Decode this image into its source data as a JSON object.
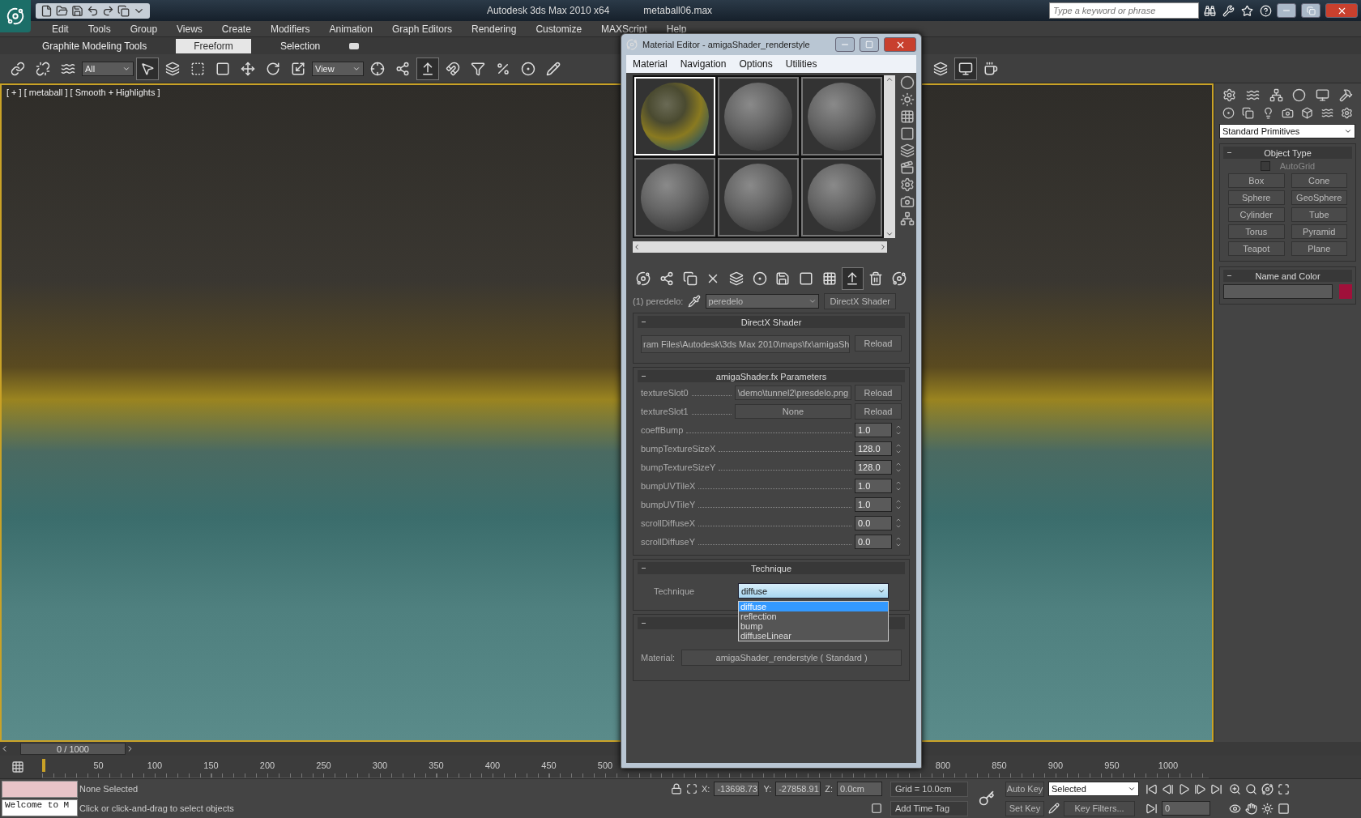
{
  "title_bar": {
    "app_title": "Autodesk 3ds Max  2010 x64",
    "file_name": "metaball06.max",
    "search": {
      "placeholder": "Type a keyword or phrase"
    }
  },
  "menu_bar": [
    "Edit",
    "Tools",
    "Group",
    "Views",
    "Create",
    "Modifiers",
    "Animation",
    "Graph Editors",
    "Rendering",
    "Customize",
    "MAXScript",
    "Help"
  ],
  "ribbon_tabs": [
    {
      "label": "Graphite Modeling Tools",
      "selected": false
    },
    {
      "label": "Freeform",
      "selected": true
    },
    {
      "label": "Selection",
      "selected": false
    }
  ],
  "main_toolbar": {
    "selection_filter": "All",
    "reference_coordinate": "View"
  },
  "viewport": {
    "label": "[ + ] [ metaball ] [ Smooth + Highlights ]"
  },
  "command_panel": {
    "category": "Standard Primitives",
    "object_type": {
      "title": "Object Type",
      "autogrid": {
        "label": "AutoGrid",
        "checked": false,
        "disabled": true
      },
      "buttons": [
        "Box",
        "Cone",
        "Sphere",
        "GeoSphere",
        "Cylinder",
        "Tube",
        "Torus",
        "Pyramid",
        "Teapot",
        "Plane"
      ]
    },
    "name_and_color": {
      "title": "Name and Color",
      "color": "#a0103a"
    }
  },
  "material_editor": {
    "title": "Material Editor - amigaShader_renderstyle",
    "menu": [
      "Material",
      "Navigation",
      "Options",
      "Utilities"
    ],
    "slots": [
      {
        "kind": "textured",
        "selected": true
      },
      {
        "kind": "plain",
        "selected": false
      },
      {
        "kind": "plain",
        "selected": false
      },
      {
        "kind": "plain",
        "selected": false
      },
      {
        "kind": "plain",
        "selected": false
      },
      {
        "kind": "plain",
        "selected": false
      }
    ],
    "material_label": "(1) peredelo:",
    "material_name": "peredelo",
    "material_type": "DirectX Shader",
    "directx_shader": {
      "title": "DirectX Shader",
      "path": "ram Files\\Autodesk\\3ds Max 2010\\maps\\fx\\amigaSh",
      "button": "Reload"
    },
    "parameters": {
      "title": "amigaShader.fx Parameters",
      "texture_slots": [
        {
          "label": "textureSlot0",
          "value": "\\demo\\tunnel2\\presdelo.png",
          "button": "Reload"
        },
        {
          "label": "textureSlot1",
          "value": "None",
          "button": "Reload"
        }
      ],
      "spinners": [
        {
          "label": "coeffBump",
          "value": "1.0"
        },
        {
          "label": "bumpTextureSizeX",
          "value": "128.0"
        },
        {
          "label": "bumpTextureSizeY",
          "value": "128.0"
        },
        {
          "label": "bumpUVTileX",
          "value": "1.0"
        },
        {
          "label": "bumpUVTileY",
          "value": "1.0"
        },
        {
          "label": "scrollDiffuseX",
          "value": "0.0"
        },
        {
          "label": "scrollDiffuseY",
          "value": "0.0"
        }
      ]
    },
    "technique": {
      "title": "Technique",
      "label": "Technique",
      "value": "diffuse",
      "expanded": true,
      "options": [
        {
          "label": "diffuse",
          "selected": true
        },
        {
          "label": "reflection",
          "selected": false
        },
        {
          "label": "bump",
          "selected": false
        },
        {
          "label": "diffuseLinear",
          "selected": false
        }
      ]
    },
    "render_style": {
      "material_label": "Material:",
      "material_value": "amigaShader_renderstyle  ( Standard )"
    }
  },
  "time_slider": {
    "position": "0 / 1000"
  },
  "track_bar": {
    "ticks": [
      "50",
      "100",
      "150",
      "200",
      "250",
      "300",
      "350",
      "400",
      "450",
      "500",
      "800",
      "850",
      "900",
      "950",
      "1000"
    ]
  },
  "status_bar": {
    "listener_output": "Welcome to M",
    "selection": "None Selected",
    "prompt": "Click or click-and-drag to select objects",
    "x_label": "X:",
    "x_value": "-13698.73",
    "y_label": "Y:",
    "y_value": "-27858.91",
    "z_label": "Z:",
    "z_value": "0.0cm",
    "grid": "Grid = 10.0cm",
    "time_tag": "Add Time Tag",
    "auto_key": "Auto Key",
    "key_mode": "Selected",
    "set_key": "Set Key",
    "key_filters": "Key Filters...",
    "frame": "0"
  }
}
